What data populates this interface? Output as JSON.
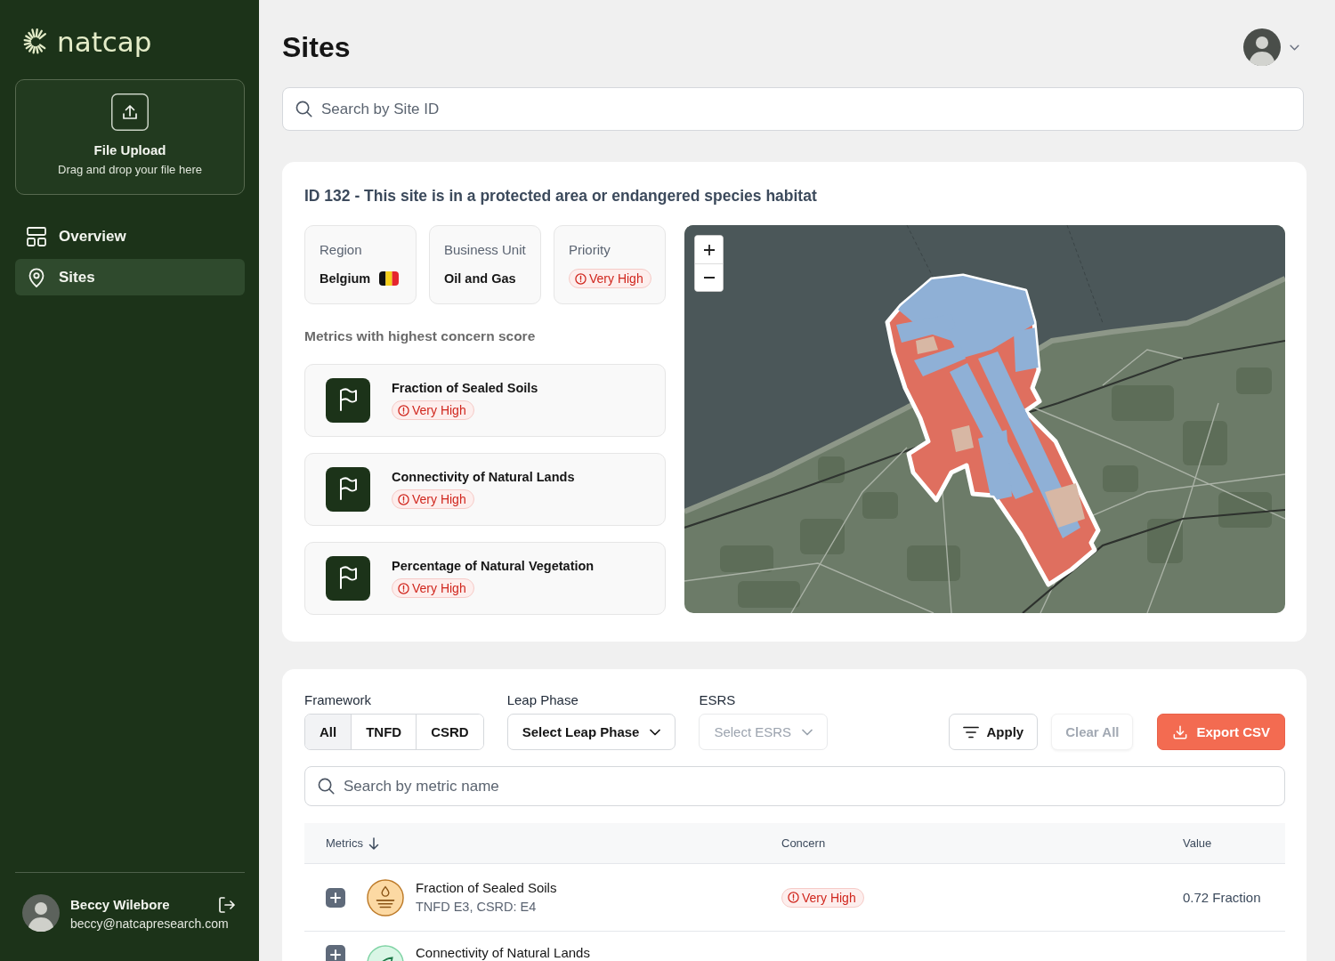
{
  "sidebar": {
    "logo": "natcap",
    "upload": {
      "title": "File Upload",
      "hint": "Drag and drop your file here"
    },
    "nav": [
      {
        "label": "Overview",
        "selected": false
      },
      {
        "label": "Sites",
        "selected": true
      }
    ],
    "user": {
      "name": "Beccy Wilebore",
      "email": "beccy@natcapresearch.com"
    }
  },
  "page": {
    "title": "Sites"
  },
  "site_search": {
    "placeholder": "Search by Site ID"
  },
  "site": {
    "heading": "**ID 132** - This site is in a protected area or endangered species habitat",
    "info": [
      {
        "kind": "region",
        "label": "Region",
        "value": "Belgium"
      },
      {
        "kind": "text",
        "label": "Business Unit",
        "value": "Oil and Gas"
      },
      {
        "kind": "badge",
        "label": "Priority",
        "value": "Very High"
      }
    ],
    "metrics_heading": "Metrics with highest concern score",
    "top_metrics": [
      {
        "name": "Fraction of Sealed Soils",
        "concern": "Very High"
      },
      {
        "name": "Connectivity of Natural Lands",
        "concern": "Very High"
      },
      {
        "name": "Percentage of Natural Vegetation",
        "concern": "Very High"
      }
    ]
  },
  "filters": {
    "framework": {
      "label": "Framework",
      "options": [
        {
          "label": "All",
          "selected": true
        },
        {
          "label": "TNFD",
          "selected": false
        },
        {
          "label": "CSRD",
          "selected": false
        }
      ]
    },
    "leap_phase": {
      "label": "Leap Phase",
      "prompt": "Select Leap Phase",
      "disabled": false
    },
    "esrs": {
      "label": "ESRS",
      "prompt": "Select ESRS",
      "disabled": true
    },
    "buttons": [
      {
        "kind": "apply",
        "label": "Apply",
        "disabled": false
      },
      {
        "kind": "clear",
        "label": "Clear All",
        "disabled": true
      },
      {
        "kind": "export",
        "label": "Export CSV",
        "disabled": false
      }
    ]
  },
  "metric_search": {
    "placeholder": "Search by metric name"
  },
  "table": {
    "columns": [
      {
        "label": "Metrics",
        "sorted": true
      },
      {
        "label": "Concern",
        "sorted": false
      },
      {
        "label": "Value",
        "sorted": false
      }
    ],
    "rows": [
      {
        "expanded": false,
        "name": "Fraction of Sealed Soils",
        "frameworks": "TNFD E3, CSRD: E4",
        "concern": "Very High",
        "value": "0.72 Fraction"
      },
      {
        "expanded": false,
        "name": "Connectivity of Natural Lands"
      }
    ]
  }
}
